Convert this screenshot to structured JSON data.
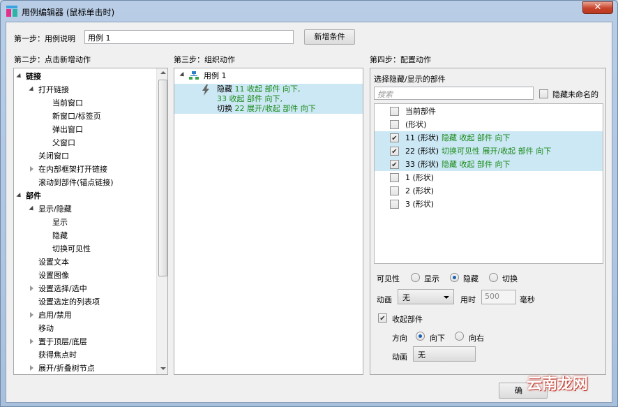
{
  "window": {
    "title": "用例编辑器 (鼠标单击时)",
    "close_label": "✕"
  },
  "step1": {
    "label": "第一步：用例说明",
    "value": "用例 1",
    "add_condition": "新增条件"
  },
  "step2": {
    "label": "第二步：点击新增动作",
    "tree": [
      {
        "label": "链接",
        "bold": true,
        "expander": "expanded"
      },
      {
        "label": "打开链接",
        "expander": "expanded"
      },
      {
        "label": "当前窗口"
      },
      {
        "label": "新窗口/标签页"
      },
      {
        "label": "弹出窗口"
      },
      {
        "label": "父窗口"
      },
      {
        "label": "关闭窗口"
      },
      {
        "label": "在内部框架打开链接",
        "expander": "collapsed"
      },
      {
        "label": "滚动到部件(锚点链接)"
      },
      {
        "label": "部件",
        "bold": true,
        "expander": "expanded"
      },
      {
        "label": "显示/隐藏",
        "expander": "expanded"
      },
      {
        "label": "显示"
      },
      {
        "label": "隐藏"
      },
      {
        "label": "切换可见性"
      },
      {
        "label": "设置文本"
      },
      {
        "label": "设置图像"
      },
      {
        "label": "设置选择/选中",
        "expander": "collapsed"
      },
      {
        "label": "设置选定的列表项"
      },
      {
        "label": "启用/禁用",
        "expander": "collapsed"
      },
      {
        "label": "移动"
      },
      {
        "label": "置于顶层/底层",
        "expander": "collapsed"
      },
      {
        "label": "获得焦点时"
      },
      {
        "label": "展开/折叠树节点",
        "expander": "collapsed"
      }
    ]
  },
  "step3": {
    "label": "第三步：组织动作",
    "case_name": "用例 1",
    "action_lines": [
      {
        "verb": "隐藏",
        "detail": "11 收起 部件 向下,"
      },
      {
        "verb": "",
        "detail": "33 收起 部件 向下,"
      },
      {
        "verb": "切换",
        "detail": "22 展开/收起 部件 向下"
      }
    ]
  },
  "step4": {
    "label": "第四步：配置动作",
    "section_title": "选择隐藏/显示的部件",
    "search_placeholder": "搜索",
    "hide_unnamed": "隐藏未命名的",
    "widgets": [
      {
        "name": "当前部件",
        "action": "",
        "checked": false
      },
      {
        "name": "(形状)",
        "action": "",
        "checked": false
      },
      {
        "name": "11 (形状)",
        "action": "隐藏 收起 部件 向下",
        "checked": true
      },
      {
        "name": "22 (形状)",
        "action": "切换可见性 展开/收起 部件 向下",
        "checked": true
      },
      {
        "name": "33 (形状)",
        "action": "隐藏 收起 部件 向下",
        "checked": true
      },
      {
        "name": "1 (形状)",
        "action": "",
        "checked": false
      },
      {
        "name": "2 (形状)",
        "action": "",
        "checked": false
      },
      {
        "name": "3 (形状)",
        "action": "",
        "checked": false
      }
    ],
    "visibility_label": "可见性",
    "visibility_options": [
      "显示",
      "隐藏",
      "切换"
    ],
    "visibility_selected": "隐藏",
    "animation_label": "动画",
    "animation_value": "无",
    "duration_label": "用时",
    "duration_value": "500",
    "duration_unit": "毫秒",
    "collapse_label": "收起部件",
    "collapse_checked": true,
    "direction_label": "方向",
    "direction_options": [
      "向下",
      "向右"
    ],
    "direction_selected": "向下",
    "collapse_animation_label": "动画",
    "collapse_animation_value": "无"
  },
  "footer": {
    "ok_label": "确"
  },
  "watermark": "云南龙网",
  "colors": {
    "selection": "#cce8f4",
    "action_green": "#1a8a1a",
    "accent_blue": "#1a5fb4"
  }
}
